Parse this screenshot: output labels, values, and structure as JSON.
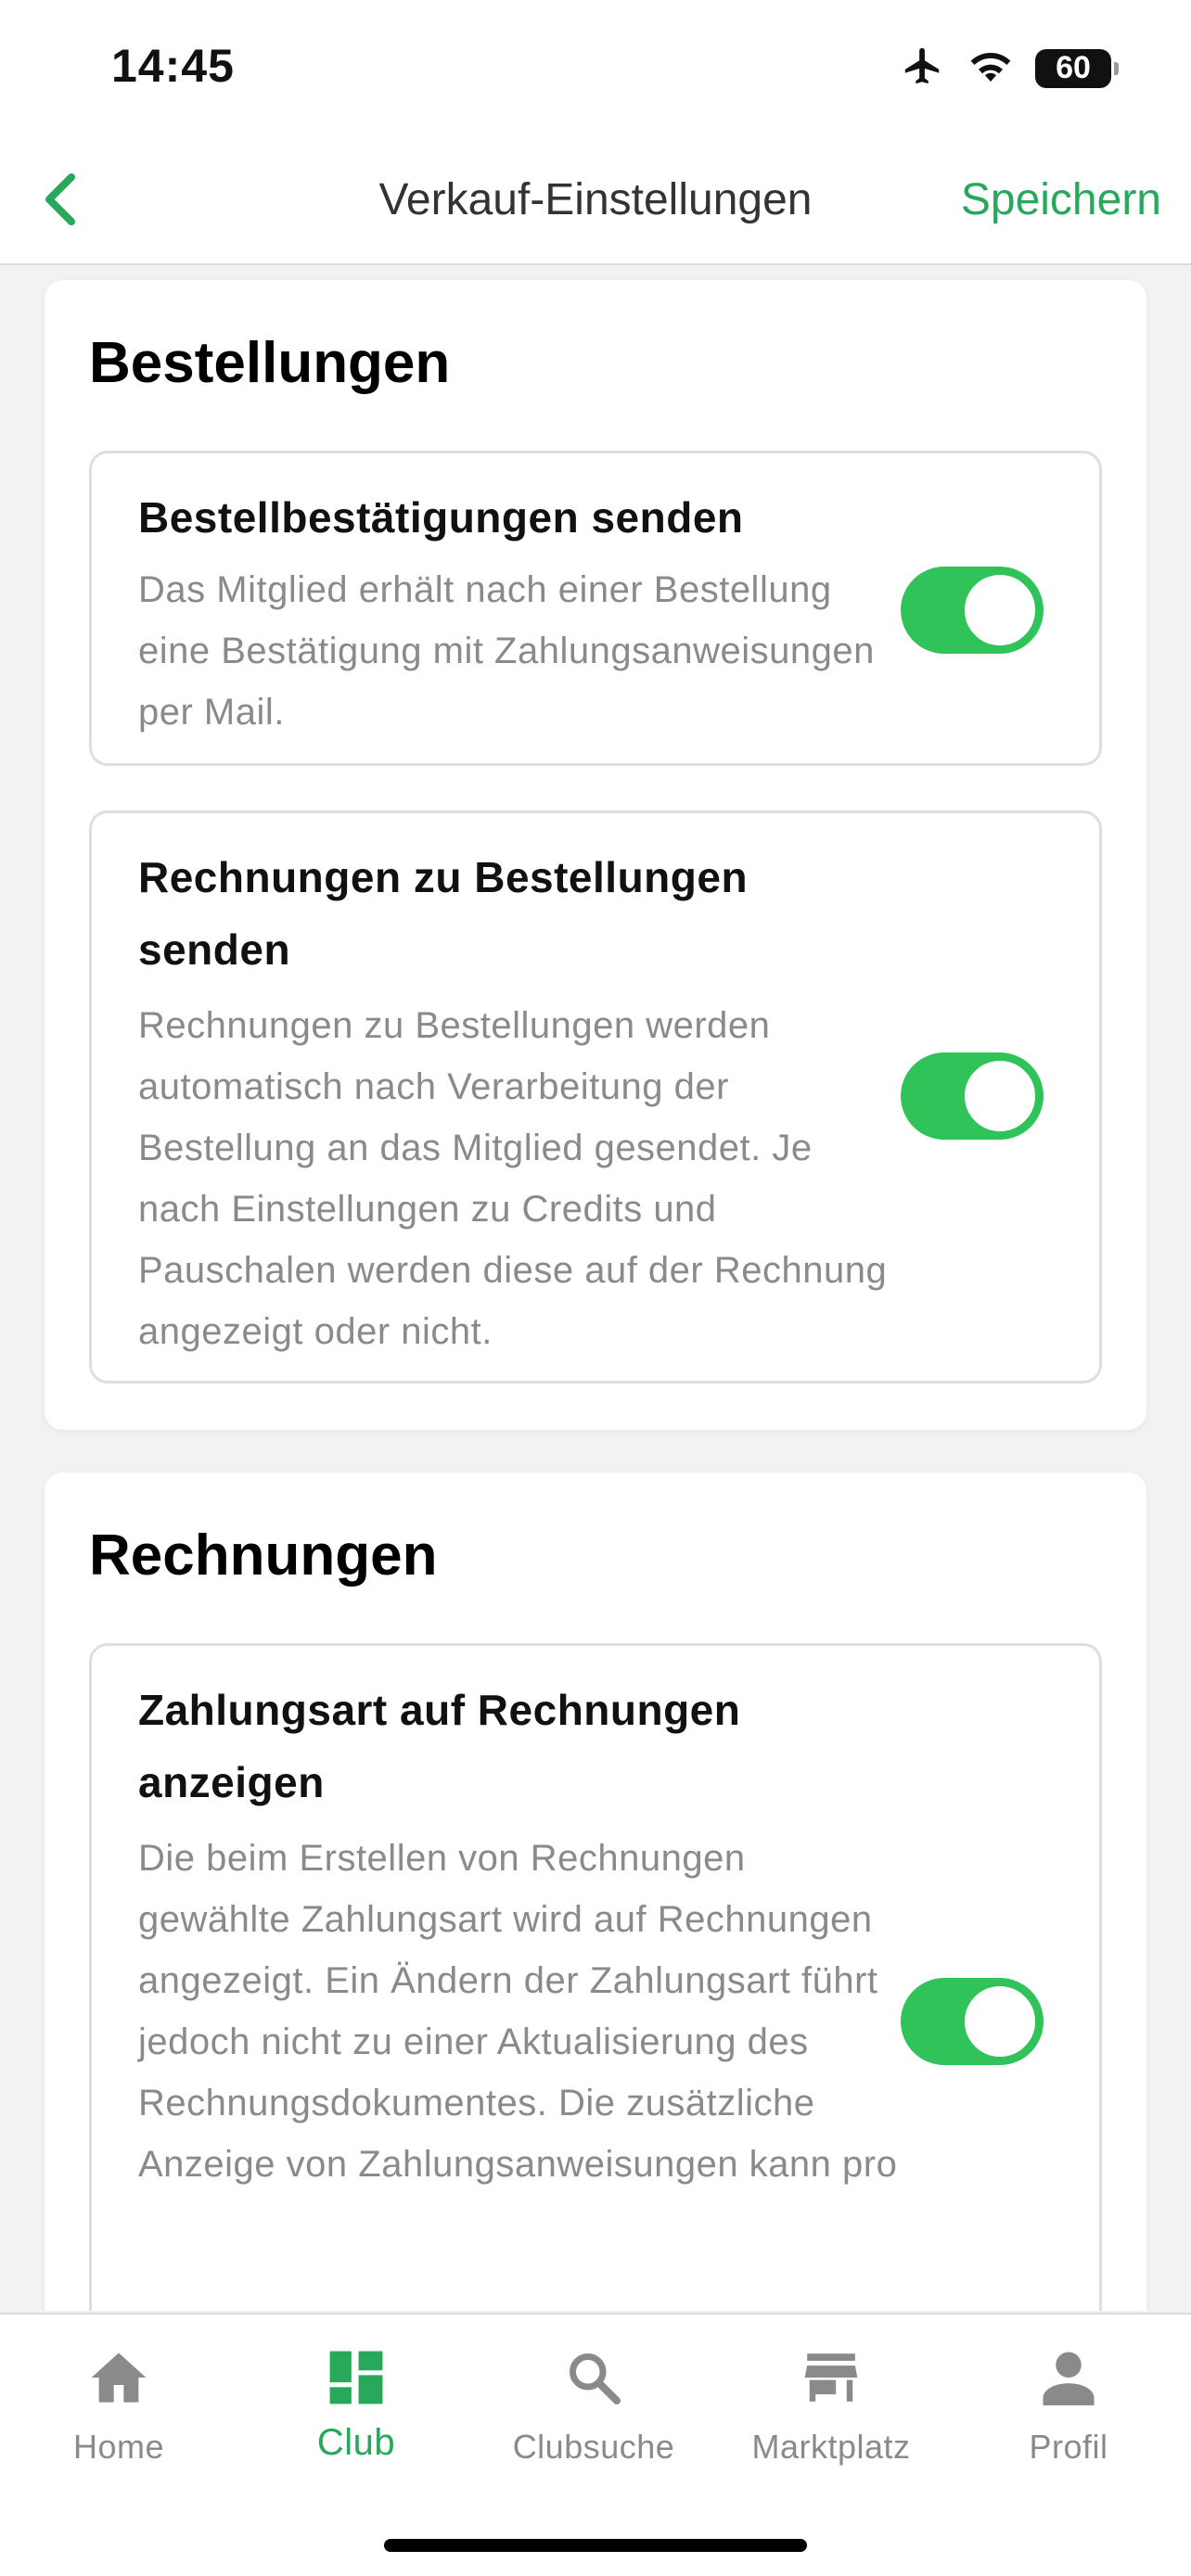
{
  "status": {
    "time": "14:45",
    "battery": "60"
  },
  "nav": {
    "title": "Verkauf-Einstellungen",
    "save": "Speichern"
  },
  "sections": [
    {
      "title": "Bestellungen",
      "settings": [
        {
          "title": "Bestellbestätigungen senden",
          "desc": "Das Mitglied erhält nach einer Bestellung eine Bestätigung mit Zahlungsanweisungen per Mail.",
          "enabled": true
        },
        {
          "title": "Rechnungen zu Bestellungen senden",
          "desc": "Rechnungen zu Bestellungen werden automatisch nach Verarbeitung der Bestellung an das Mitglied gesendet. Je nach Einstellungen zu Credits und Pauschalen werden diese auf der Rechnung angezeigt oder nicht.",
          "enabled": true
        }
      ]
    },
    {
      "title": "Rechnungen",
      "settings": [
        {
          "title": "Zahlungsart auf Rechnungen anzeigen",
          "desc": "Die beim Erstellen von Rechnungen gewählte Zahlungsart wird auf Rechnungen angezeigt. Ein Ändern der Zahlungsart führt jedoch nicht zu einer Aktualisierung des Rechnungsdokumentes. Die zusätzliche Anzeige von Zahlungsanweisungen kann pro",
          "enabled": true
        }
      ]
    }
  ],
  "tabs": [
    {
      "label": "Home",
      "icon": "home-icon",
      "active": false
    },
    {
      "label": "Club",
      "icon": "club-grid-icon",
      "active": true
    },
    {
      "label": "Clubsuche",
      "icon": "search-icon",
      "active": false
    },
    {
      "label": "Marktplatz",
      "icon": "store-icon",
      "active": false
    },
    {
      "label": "Profil",
      "icon": "profile-icon",
      "active": false
    }
  ],
  "colors": {
    "accent": "#27a85a",
    "toggle_on": "#2fc35a",
    "muted_text": "#8a8a8a",
    "background": "#f2f2f4"
  }
}
